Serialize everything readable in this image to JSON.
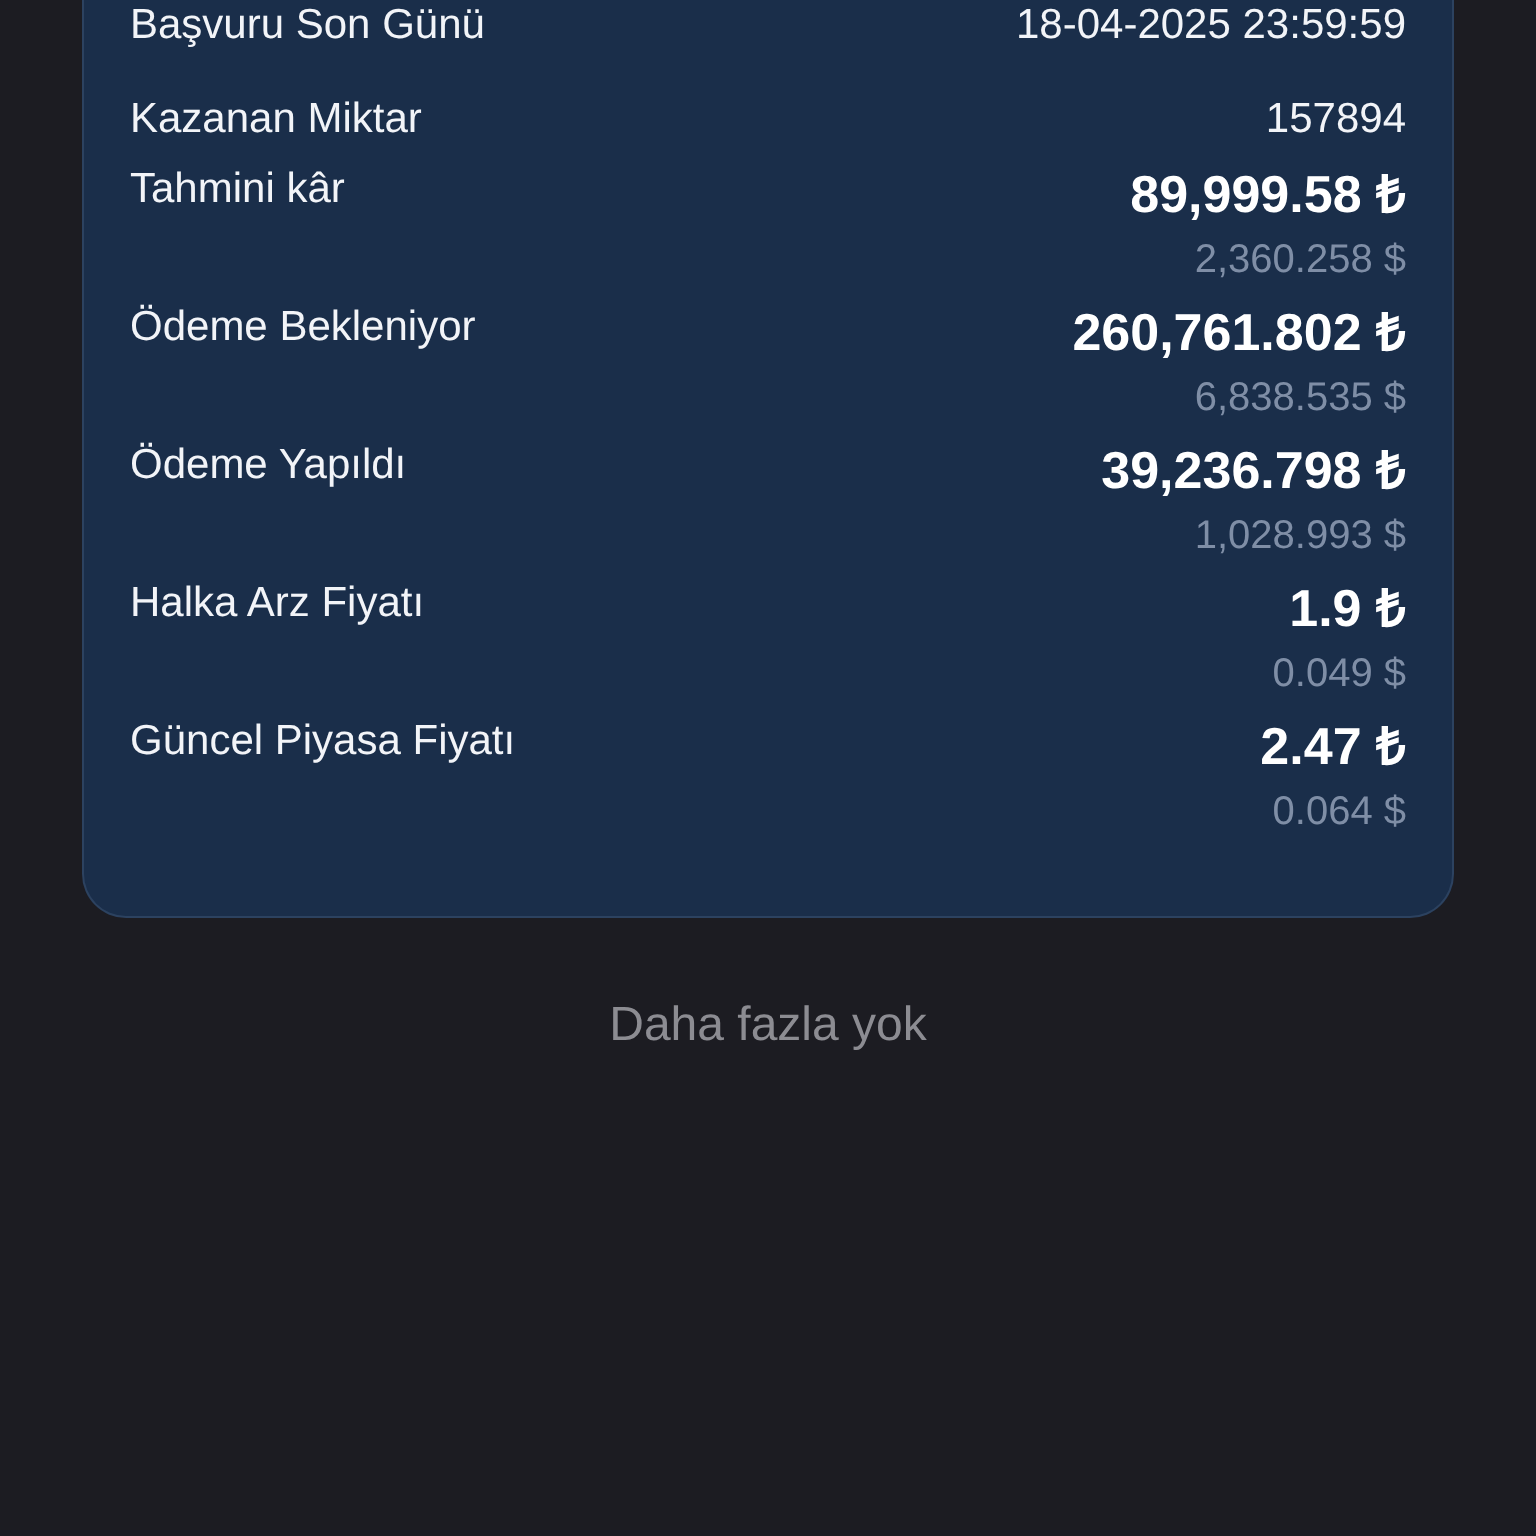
{
  "details": [
    {
      "kind": "text",
      "label": "Başvuru Son Günü",
      "value": "18-04-2025 23:59:59"
    },
    {
      "kind": "text",
      "label": "Kazanan Miktar",
      "value": "157894"
    },
    {
      "kind": "amount",
      "label": "Tahmini kâr",
      "value": "89,999.58 ₺",
      "secondary": "2,360.258 $"
    },
    {
      "kind": "amount",
      "label": "Ödeme Bekleniyor",
      "value": "260,761.802 ₺",
      "secondary": "6,838.535 $"
    },
    {
      "kind": "amount",
      "label": "Ödeme Yapıldı",
      "value": "39,236.798 ₺",
      "secondary": "1,028.993 $"
    },
    {
      "kind": "amount",
      "label": "Halka Arz Fiyatı",
      "value": "1.9 ₺",
      "secondary": "0.049 $"
    },
    {
      "kind": "amount",
      "label": "Güncel Piyasa Fiyatı",
      "value": "2.47 ₺",
      "secondary": "0.064 $"
    }
  ],
  "footer": "Daha fazla yok"
}
